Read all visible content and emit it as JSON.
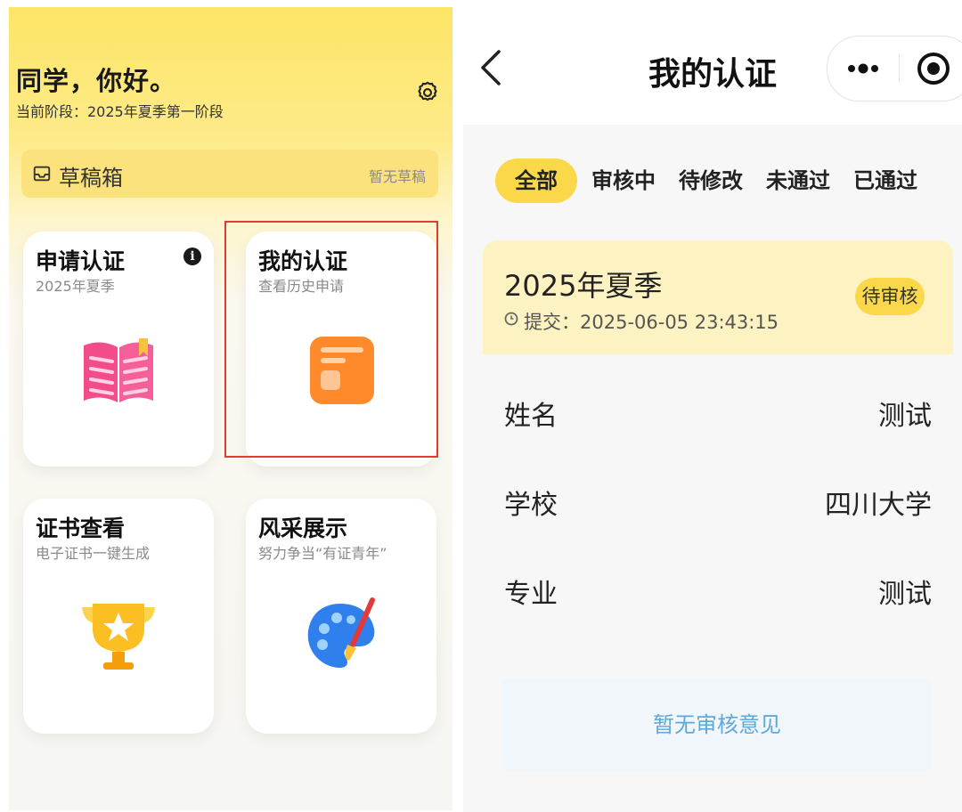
{
  "home": {
    "greeting": "同学，你好。",
    "stage": "当前阶段：2025年夏季第一阶段",
    "drafts": {
      "label": "草稿箱",
      "status": "暂无草稿"
    },
    "cards": [
      {
        "title": "申请认证",
        "subtitle": "2025年夏季",
        "icon": "book-icon"
      },
      {
        "title": "我的认证",
        "subtitle": "查看历史申请",
        "icon": "document-icon"
      },
      {
        "title": "证书查看",
        "subtitle": "电子证书一键生成",
        "icon": "trophy-icon"
      },
      {
        "title": "风采展示",
        "subtitle": "努力争当“有证青年”",
        "icon": "palette-icon"
      }
    ]
  },
  "cert_page": {
    "title": "我的认证",
    "tabs": [
      "全部",
      "审核中",
      "待修改",
      "未通过",
      "已通过"
    ],
    "active_tab": "全部",
    "record": {
      "season": "2025年夏季",
      "submitted": "提交：2025-06-05 23:43:15",
      "status": "待审核"
    },
    "fields": [
      {
        "label": "姓名",
        "value": "测试"
      },
      {
        "label": "学校",
        "value": "四川大学"
      },
      {
        "label": "专业",
        "value": "测试"
      }
    ],
    "opinion": "暂无审核意见"
  },
  "colors": {
    "accent": "#fbd84a",
    "highlight_border": "#e03c31",
    "link_blue": "#5fa8dc"
  }
}
